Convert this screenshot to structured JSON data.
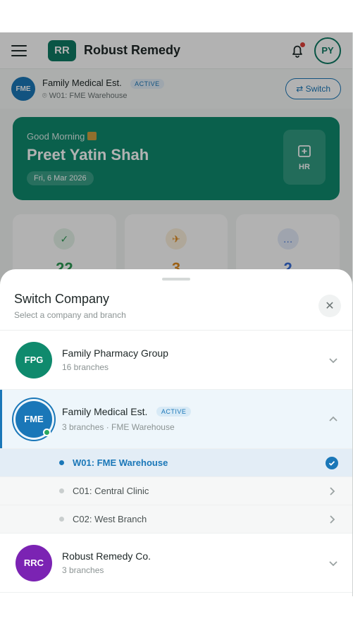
{
  "app": {
    "brand_initials": "RR",
    "brand_name": "Robust Remedy",
    "user_initials": "PY"
  },
  "context": {
    "company_initials": "FME",
    "company_name": "Family Medical Est.",
    "status": "ACTIVE",
    "branch": "W01: FME Warehouse",
    "switch_label": "Switch"
  },
  "hero": {
    "greeting": "Good Morning",
    "name": "Preet Yatin Shah",
    "date": "Fri, 6 Mar 2026",
    "hr_label": "HR"
  },
  "stats": [
    {
      "value": "22",
      "color": "#2e9a55",
      "bg": "#e4f3e8"
    },
    {
      "value": "3",
      "color": "#e08a1e",
      "bg": "#fbefdc"
    },
    {
      "value": "2",
      "color": "#3a6fd8",
      "bg": "#e4ebfa"
    }
  ],
  "sheet": {
    "title": "Switch Company",
    "subtitle": "Select a company and branch",
    "companies": [
      {
        "initials": "FPG",
        "name": "Family Pharmacy Group",
        "meta": "16 branches",
        "color": "#0f8a6d"
      },
      {
        "initials": "FME",
        "name": "Family Medical Est.",
        "status": "ACTIVE",
        "meta": "3 branches · FME Warehouse",
        "color": "#1a77b8"
      },
      {
        "initials": "RRC",
        "name": "Robust Remedy Co.",
        "meta": "3 branches",
        "color": "#7b23b3"
      }
    ],
    "branches": [
      {
        "label": "W01: FME Warehouse"
      },
      {
        "label": "C01: Central Clinic"
      },
      {
        "label": "C02: West Branch"
      }
    ]
  }
}
